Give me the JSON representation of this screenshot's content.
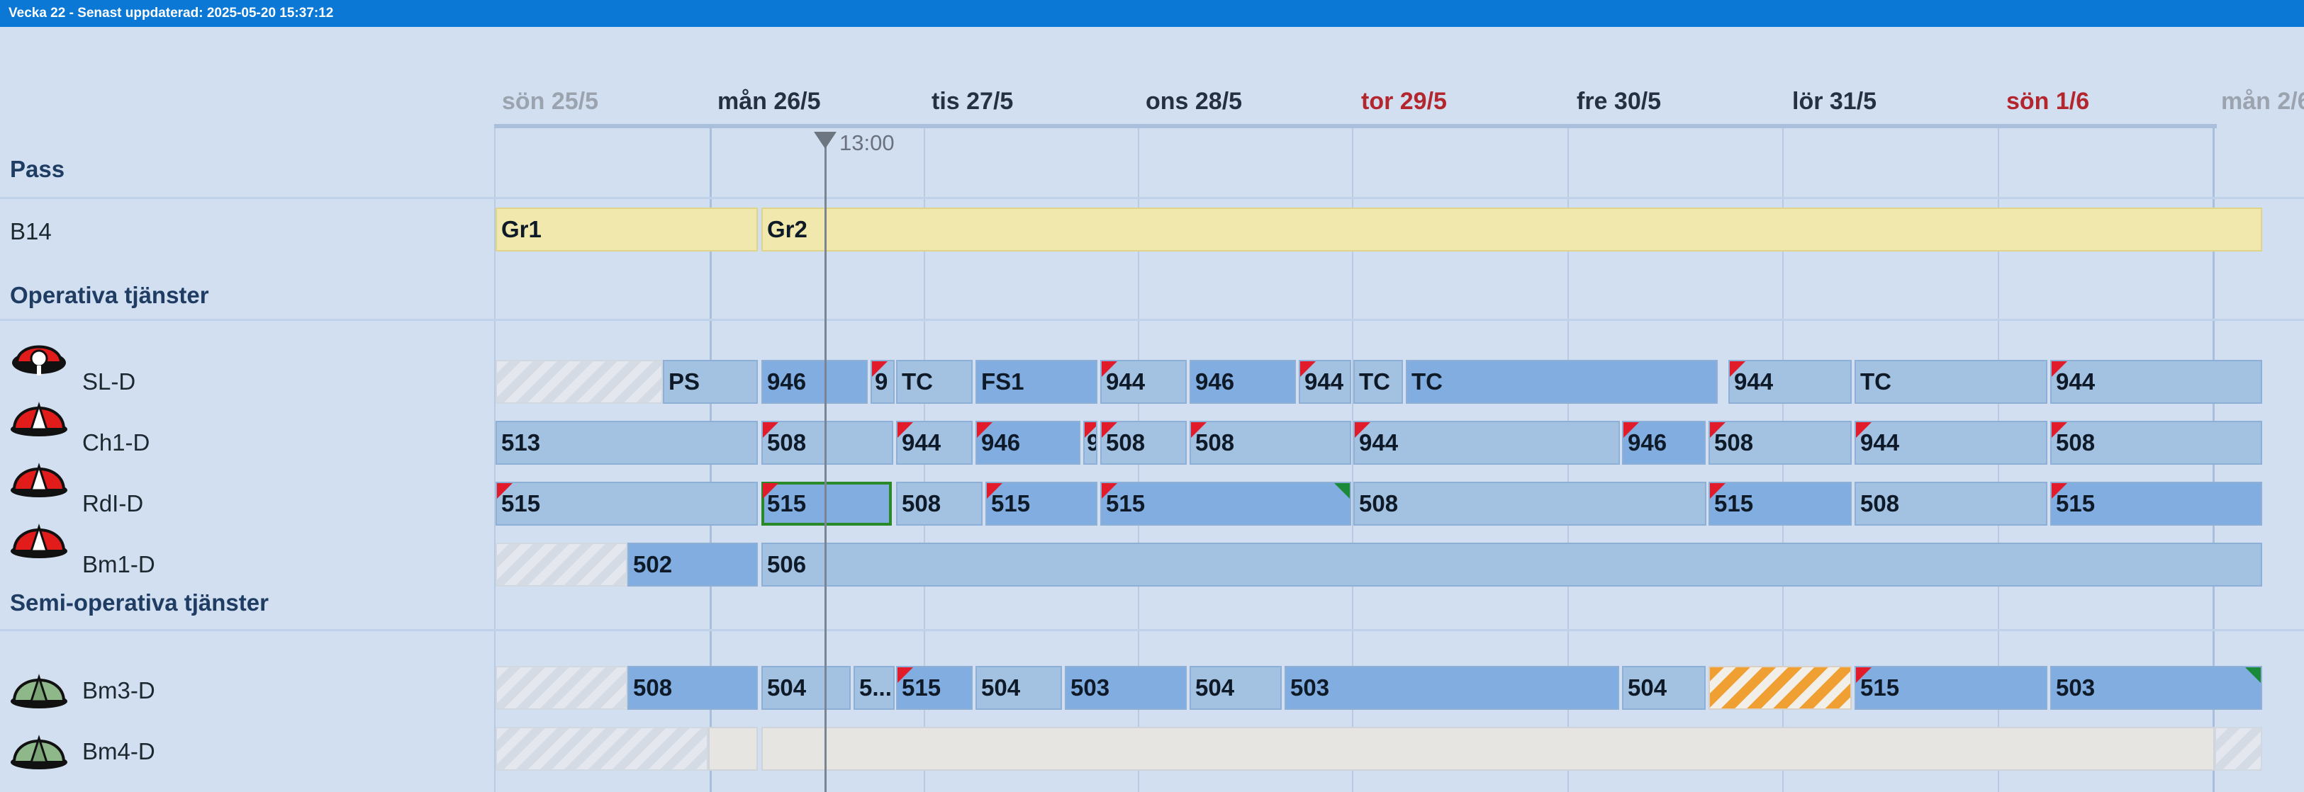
{
  "title": "Vecka 22 - Senast uppdaterad: 2025-05-20 15:37:12",
  "days": [
    "sön 25/5",
    "mån 26/5",
    "tis 27/5",
    "ons 28/5",
    "tor 29/5",
    "fre 30/5",
    "lör 31/5",
    "sön 1/6",
    "mån 2/6"
  ],
  "now_label": "13:00",
  "sections": {
    "pass": "Pass",
    "operativa": "Operativa tjänster",
    "semi": "Semi-operativa tjänster"
  },
  "rows": {
    "b14": {
      "label": "B14",
      "shifts": [
        "Gr1",
        "Gr2"
      ]
    },
    "sl": {
      "label": "SL-D",
      "shifts": [
        "PS",
        "946",
        "9",
        "TC",
        "FS1",
        "944",
        "946",
        "944",
        "TC",
        "TC",
        "944",
        "TC",
        "944"
      ]
    },
    "ch1": {
      "label": "Ch1-D",
      "shifts": [
        "513",
        "508",
        "944",
        "946",
        "9",
        "508",
        "508",
        "944",
        "946",
        "508",
        "944",
        "508"
      ]
    },
    "rdl": {
      "label": "RdI-D",
      "shifts": [
        "515",
        "515",
        "508",
        "515",
        "515",
        "508",
        "515",
        "508",
        "515"
      ]
    },
    "bm1": {
      "label": "Bm1-D",
      "shifts": [
        "502",
        "506"
      ]
    },
    "bm3": {
      "label": "Bm3-D",
      "shifts": [
        "508",
        "504",
        "5...",
        "515",
        "504",
        "503",
        "504",
        "503",
        "504",
        "515",
        "503"
      ]
    },
    "bm4": {
      "label": "Bm4-D",
      "shifts": []
    }
  },
  "colors": {
    "title_bar": "#0a78d4",
    "weekend_red": "#b3262e",
    "bar_light": "#a3c1e0",
    "bar_dark": "#82ade0",
    "pass_yellow": "#f0e8ad"
  }
}
